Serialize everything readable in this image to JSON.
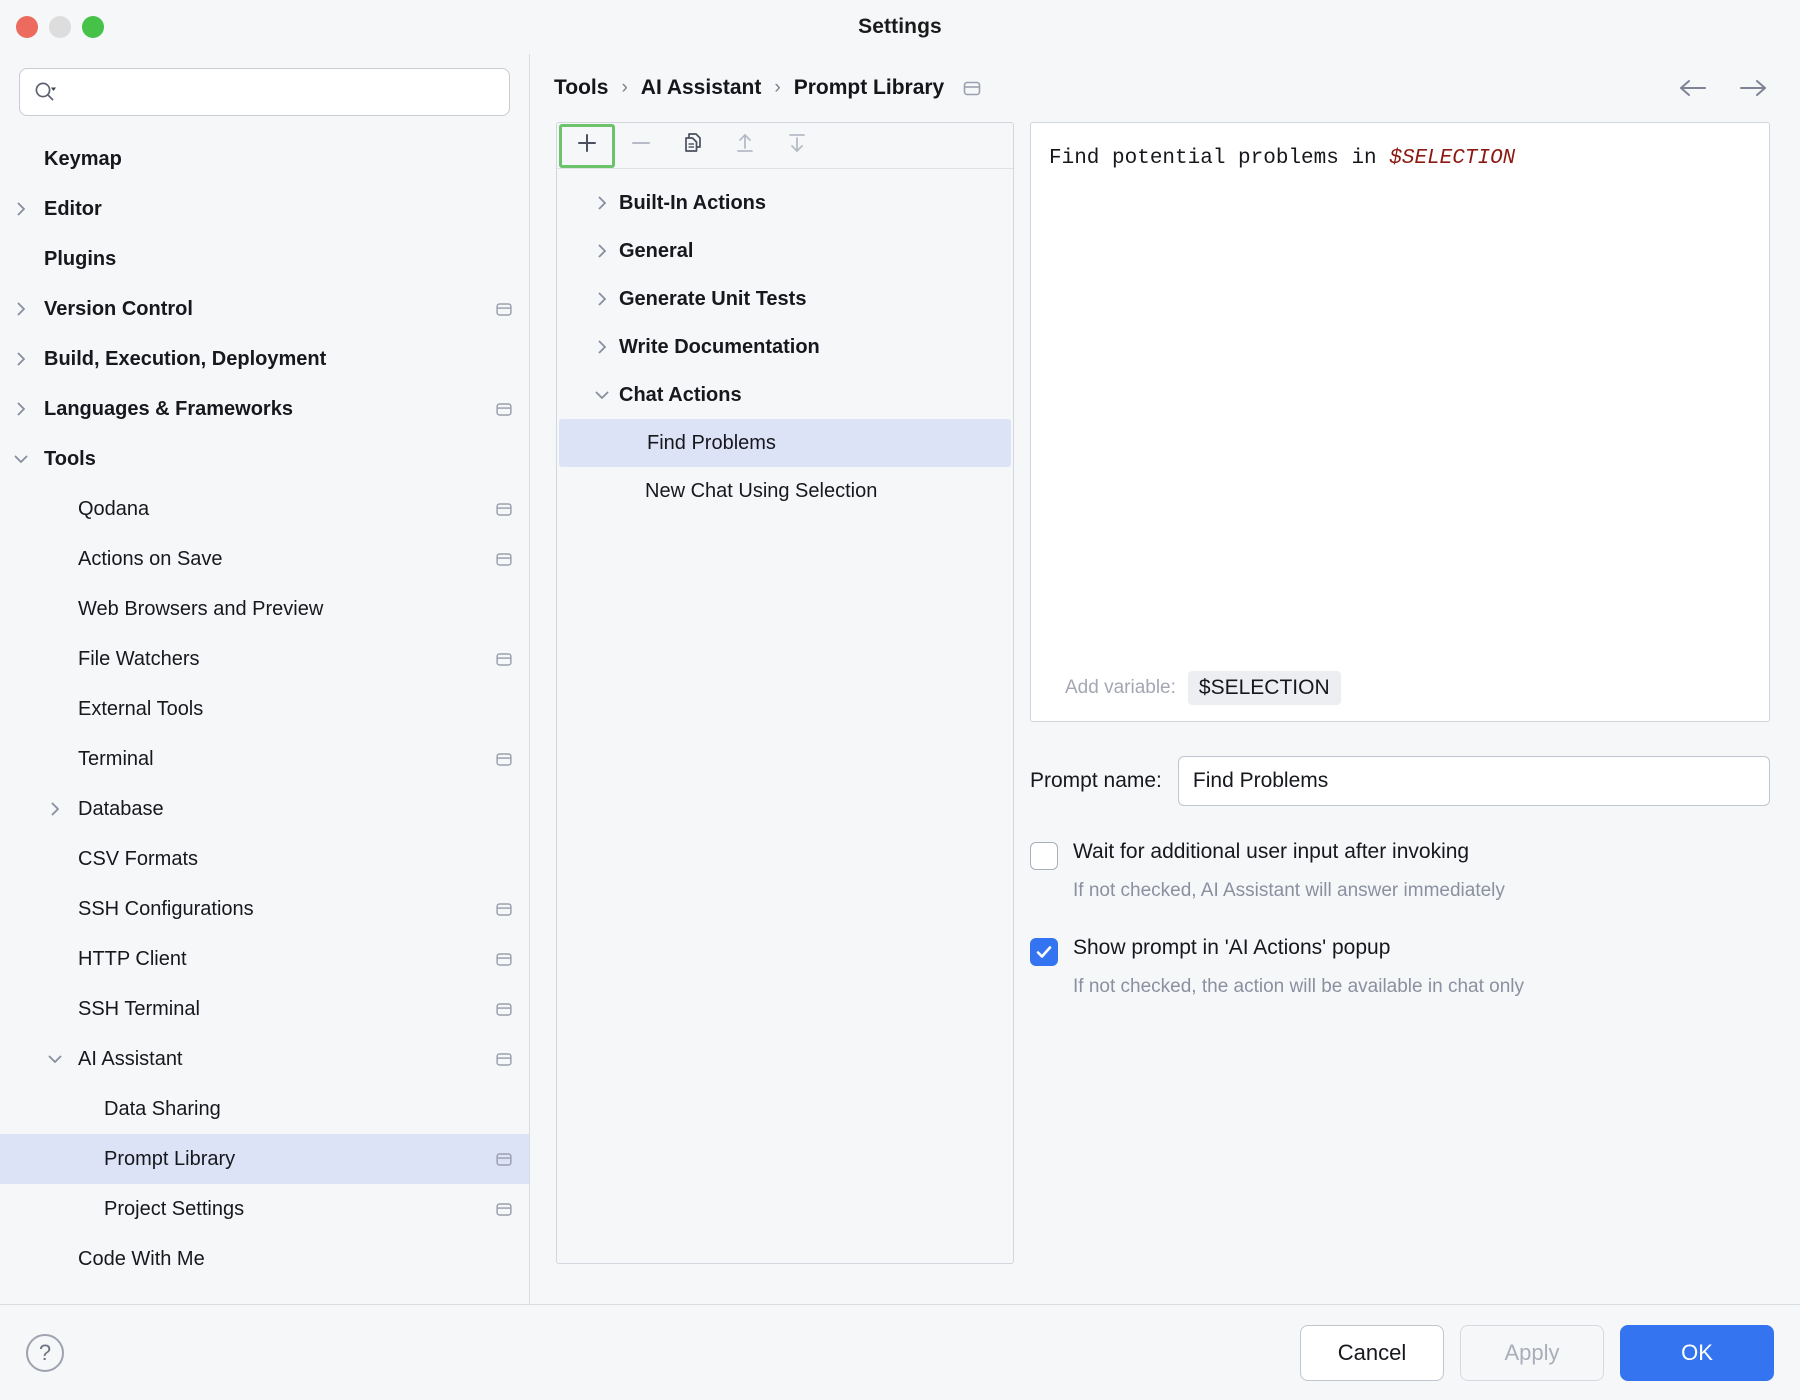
{
  "window": {
    "title": "Settings",
    "traffic_lights": [
      "close-red",
      "minimize-yellow",
      "zoom-green"
    ]
  },
  "search": {
    "value": "",
    "placeholder": "",
    "icon": "search-icon"
  },
  "sidebar": {
    "items": [
      {
        "label": "Keymap",
        "level": 0,
        "group": true,
        "arrow": "none",
        "badge": false
      },
      {
        "label": "Editor",
        "level": 0,
        "group": true,
        "arrow": "right",
        "badge": false
      },
      {
        "label": "Plugins",
        "level": 0,
        "group": true,
        "arrow": "none",
        "badge": false
      },
      {
        "label": "Version Control",
        "level": 0,
        "group": true,
        "arrow": "right",
        "badge": true
      },
      {
        "label": "Build, Execution, Deployment",
        "level": 0,
        "group": true,
        "arrow": "right",
        "badge": false
      },
      {
        "label": "Languages & Frameworks",
        "level": 0,
        "group": true,
        "arrow": "right",
        "badge": true
      },
      {
        "label": "Tools",
        "level": 0,
        "group": true,
        "arrow": "down",
        "badge": false
      },
      {
        "label": "Qodana",
        "level": 1,
        "group": false,
        "arrow": "none",
        "badge": true
      },
      {
        "label": "Actions on Save",
        "level": 1,
        "group": false,
        "arrow": "none",
        "badge": true
      },
      {
        "label": "Web Browsers and Preview",
        "level": 1,
        "group": false,
        "arrow": "none",
        "badge": false
      },
      {
        "label": "File Watchers",
        "level": 1,
        "group": false,
        "arrow": "none",
        "badge": true
      },
      {
        "label": "External Tools",
        "level": 1,
        "group": false,
        "arrow": "none",
        "badge": false
      },
      {
        "label": "Terminal",
        "level": 1,
        "group": false,
        "arrow": "none",
        "badge": true
      },
      {
        "label": "Database",
        "level": 1,
        "group": false,
        "arrow": "right",
        "badge": false
      },
      {
        "label": "CSV Formats",
        "level": 1,
        "group": false,
        "arrow": "none",
        "badge": false
      },
      {
        "label": "SSH Configurations",
        "level": 1,
        "group": false,
        "arrow": "none",
        "badge": true
      },
      {
        "label": "HTTP Client",
        "level": 1,
        "group": false,
        "arrow": "none",
        "badge": true
      },
      {
        "label": "SSH Terminal",
        "level": 1,
        "group": false,
        "arrow": "none",
        "badge": true
      },
      {
        "label": "AI Assistant",
        "level": 1,
        "group": false,
        "arrow": "down",
        "badge": true
      },
      {
        "label": "Data Sharing",
        "level": 2,
        "group": false,
        "arrow": "none",
        "badge": false
      },
      {
        "label": "Prompt Library",
        "level": 2,
        "group": false,
        "arrow": "none",
        "badge": true,
        "selected": true
      },
      {
        "label": "Project Settings",
        "level": 2,
        "group": false,
        "arrow": "none",
        "badge": true
      },
      {
        "label": "Code With Me",
        "level": 1,
        "group": false,
        "arrow": "none",
        "badge": false
      }
    ]
  },
  "breadcrumb": {
    "parts": [
      "Tools",
      "AI Assistant",
      "Prompt Library"
    ],
    "separator": "›",
    "badge_icon": "project-scope-icon",
    "back_icon": "arrow-left-icon",
    "forward_icon": "arrow-right-icon"
  },
  "prompt_toolbar": {
    "buttons": [
      {
        "name": "add-prompt-button",
        "icon": "plus-icon",
        "highlighted": true,
        "enabled": true
      },
      {
        "name": "remove-prompt-button",
        "icon": "minus-icon",
        "highlighted": false,
        "enabled": false
      },
      {
        "name": "copy-prompt-button",
        "icon": "copy-icon",
        "highlighted": false,
        "enabled": true
      },
      {
        "name": "import-button",
        "icon": "arrow-up-icon",
        "highlighted": false,
        "enabled": false
      },
      {
        "name": "export-button",
        "icon": "arrow-down-icon",
        "highlighted": false,
        "enabled": false
      }
    ]
  },
  "prompt_tree": {
    "items": [
      {
        "label": "Built-In Actions",
        "group": true,
        "arrow": "right",
        "selected": false
      },
      {
        "label": "General",
        "group": true,
        "arrow": "right",
        "selected": false
      },
      {
        "label": "Generate Unit Tests",
        "group": true,
        "arrow": "right",
        "selected": false
      },
      {
        "label": "Write Documentation",
        "group": true,
        "arrow": "right",
        "selected": false
      },
      {
        "label": "Chat Actions",
        "group": true,
        "arrow": "down",
        "selected": false
      },
      {
        "label": "Find Problems",
        "group": false,
        "arrow": "none",
        "selected": true
      },
      {
        "label": "New Chat Using Selection",
        "group": false,
        "arrow": "none",
        "selected": false
      }
    ]
  },
  "editor": {
    "prompt_prefix": "Find potential problems in ",
    "prompt_variable": "$SELECTION",
    "add_variable_label": "Add variable:",
    "variable_chip": "$SELECTION"
  },
  "form": {
    "prompt_name_label": "Prompt name:",
    "prompt_name_value": "Find Problems",
    "checkboxes": [
      {
        "label": "Wait for additional user input after invoking",
        "hint": "If not checked, AI Assistant will answer immediately",
        "checked": false
      },
      {
        "label": "Show prompt in 'AI Actions' popup",
        "hint": "If not checked, the action will be available in chat only",
        "checked": true
      }
    ]
  },
  "footer": {
    "help_icon": "question-mark-icon",
    "cancel_label": "Cancel",
    "apply_label": "Apply",
    "apply_enabled": false,
    "ok_label": "OK"
  },
  "colors": {
    "accent_blue": "#3574f0",
    "selection_blue": "#dde3f7",
    "highlight_green": "#6cc36c",
    "variable_red": "#8c1a12",
    "window_bg": "#f6f7f9"
  }
}
